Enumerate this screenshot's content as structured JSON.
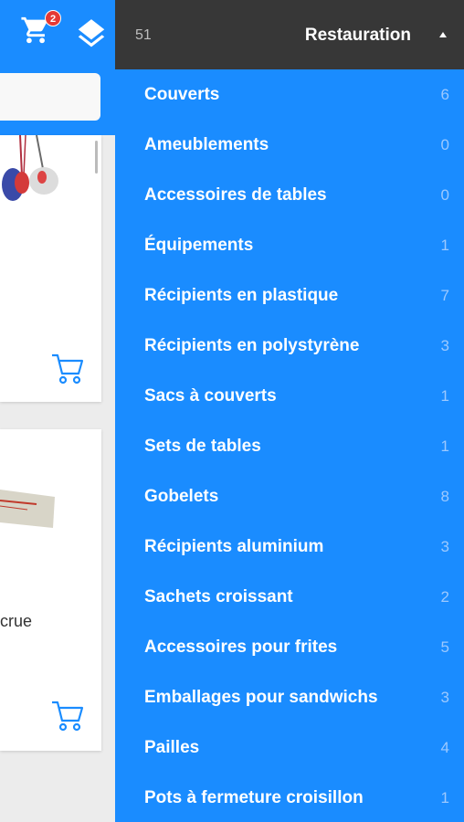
{
  "topbar": {
    "cart_badge": "2",
    "icons": {
      "cart": "cart-icon",
      "layers": "layers-icon"
    }
  },
  "search": {
    "value": ""
  },
  "cards": [
    {
      "title": "",
      "icon": "add-to-cart-icon"
    },
    {
      "title": "crue",
      "icon": "add-to-cart-icon"
    }
  ],
  "drawer": {
    "header": {
      "count": "51",
      "title": "Restauration",
      "icon": "caret-up-icon"
    },
    "items": [
      {
        "label": "Couverts",
        "count": "6"
      },
      {
        "label": "Ameublements",
        "count": "0"
      },
      {
        "label": "Accessoires de tables",
        "count": "0"
      },
      {
        "label": "Équipements",
        "count": "1"
      },
      {
        "label": "Récipients en plastique",
        "count": "7"
      },
      {
        "label": "Récipients en polystyrène",
        "count": "3"
      },
      {
        "label": "Sacs à couverts",
        "count": "1"
      },
      {
        "label": "Sets de tables",
        "count": "1"
      },
      {
        "label": "Gobelets",
        "count": "8"
      },
      {
        "label": "Récipients aluminium",
        "count": "3"
      },
      {
        "label": "Sachets croissant",
        "count": "2"
      },
      {
        "label": "Accessoires pour frites",
        "count": "5"
      },
      {
        "label": "Emballages pour sandwichs",
        "count": "3"
      },
      {
        "label": "Pailles",
        "count": "4"
      },
      {
        "label": "Pots à fermeture croisillon",
        "count": "1"
      }
    ]
  },
  "colors": {
    "primary": "#1a8cff",
    "header": "#373737",
    "badge": "#e53935",
    "count_text": "#9cc9ff"
  }
}
